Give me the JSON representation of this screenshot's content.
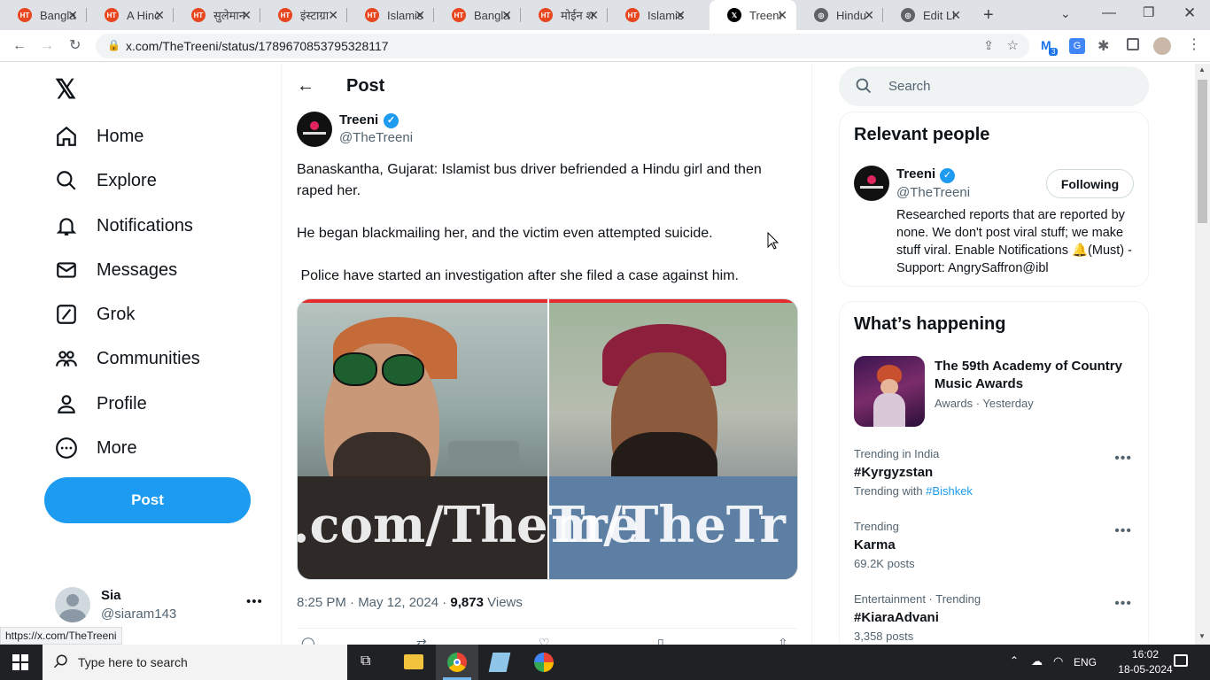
{
  "tabs": [
    {
      "title": "Bangla",
      "icon": "hindutva-icon"
    },
    {
      "title": "A Hinc",
      "icon": "hindutva-icon"
    },
    {
      "title": "सुलेमान",
      "icon": "hindutva-icon"
    },
    {
      "title": "इंस्टाग्रा",
      "icon": "hindutva-icon"
    },
    {
      "title": "Islamis",
      "icon": "hindutva-icon"
    },
    {
      "title": "Bangla",
      "icon": "hindutva-icon"
    },
    {
      "title": "मोईन श",
      "icon": "hindutva-icon"
    },
    {
      "title": "Islamis",
      "icon": "hindutva-icon"
    },
    {
      "title": "Treeni",
      "icon": "x-icon"
    },
    {
      "title": "Hindu",
      "icon": "globe-icon"
    },
    {
      "title": "Edit Li",
      "icon": "globe-icon"
    }
  ],
  "address_bar": {
    "url": "x.com/TheTreeni/status/1789670853795328117"
  },
  "extensions": {
    "badge_count": "3"
  },
  "sidebar": {
    "items": [
      {
        "label": "Home"
      },
      {
        "label": "Explore"
      },
      {
        "label": "Notifications"
      },
      {
        "label": "Messages"
      },
      {
        "label": "Grok"
      },
      {
        "label": "Communities"
      },
      {
        "label": "Profile"
      },
      {
        "label": "More"
      }
    ],
    "post_button": "Post",
    "account": {
      "name": "Sia",
      "handle": "@siaram143"
    }
  },
  "header": {
    "title": "Post"
  },
  "tweet": {
    "author_name": "Treeni",
    "author_handle": "@TheTreeni",
    "paragraphs": [
      "Banaskantha, Gujarat: Islamist bus driver befriended a Hindu girl and then raped her.",
      "He began blackmailing her, and the victim even attempted suicide.",
      " Police have started an investigation after she filed a case against him."
    ],
    "watermark_left": ".com/TheTre",
    "watermark_right": "m/TheTr",
    "timestamp": "8:25 PM · May 12, 2024 · ",
    "views_count": "9,873",
    "views_label": " Views"
  },
  "search": {
    "placeholder": "Search"
  },
  "relevant_people": {
    "title": "Relevant people",
    "name": "Treeni",
    "handle": "@TheTreeni",
    "follow_label": "Following",
    "bio": "Researched reports that are reported by none. We don't post viral stuff; we make stuff viral. Enable Notifications 🔔(Must) - Support: AngrySaffron@ibl"
  },
  "whats_happening": {
    "title": "What’s happening",
    "featured": {
      "title": "The 59th Academy of Country Music Awards",
      "meta": "Awards · Yesterday"
    },
    "trends": [
      {
        "meta": "Trending in India",
        "title": "#Kyrgyzstan",
        "sub_prefix": "Trending with ",
        "sub_link": "#Bishkek"
      },
      {
        "meta": "Trending",
        "title": "Karma",
        "sub_prefix": "69.2K posts",
        "sub_link": ""
      },
      {
        "meta": "Entertainment · Trending",
        "title": "#KiaraAdvani",
        "sub_prefix": "3,358 posts",
        "sub_link": ""
      }
    ]
  },
  "status_url": "https://x.com/TheTreeni",
  "taskbar": {
    "search_placeholder": "Type here to search",
    "language": "ENG",
    "time": "16:02",
    "date": "18-05-2024"
  },
  "colors": {
    "accent": "#1d9bf0",
    "text": "#0f1419",
    "muted": "#536471",
    "taskbar": "#202124"
  }
}
